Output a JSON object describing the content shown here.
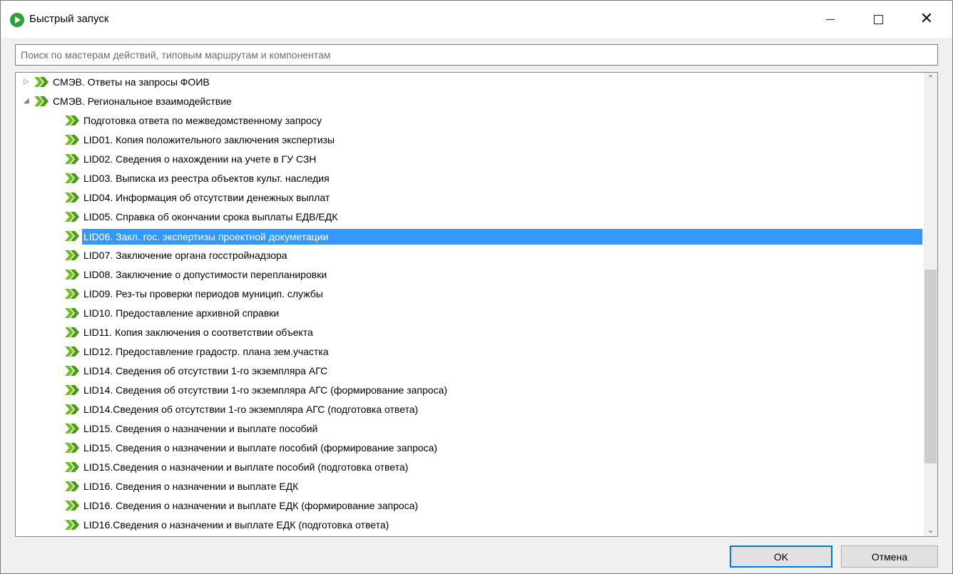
{
  "window": {
    "title": "Быстрый запуск",
    "icon": "play-circle-icon",
    "accent": "#2e9f3a",
    "selection_color": "#3399ff"
  },
  "search": {
    "placeholder": "Поиск по мастерам действий, типовым маршрутам и компонентам",
    "value": ""
  },
  "tree": {
    "items": [
      {
        "level": 0,
        "expander": "collapsed",
        "label": "СМЭВ. Ответы на запросы ФОИВ"
      },
      {
        "level": 0,
        "expander": "expanded",
        "label": "СМЭВ. Региональное взаимодействие"
      },
      {
        "level": 1,
        "label": " Подготовка ответа по межведомственному запросу"
      },
      {
        "level": 1,
        "label": "LID01. Копия положительного заключения экспертизы"
      },
      {
        "level": 1,
        "label": "LID02. Сведения о нахождении на учете в ГУ СЗН"
      },
      {
        "level": 1,
        "label": "LID03. Выписка из реестра объектов культ. наследия"
      },
      {
        "level": 1,
        "label": "LID04. Информация об отсутствии денежных выплат"
      },
      {
        "level": 1,
        "label": "LID05. Справка об окончании срока выплаты ЕДВ/ЕДК"
      },
      {
        "level": 1,
        "label": "LID06. Закл. гос. экспертизы проектной докуметации",
        "selected": true
      },
      {
        "level": 1,
        "label": "LID07. Заключение органа госстройнадзора"
      },
      {
        "level": 1,
        "label": "LID08. Заключение о допустимости перепланировки"
      },
      {
        "level": 1,
        "label": "LID09. Рез-ты проверки периодов муницип. службы"
      },
      {
        "level": 1,
        "label": "LID10. Предоставление архивной справки"
      },
      {
        "level": 1,
        "label": "LID11. Копия заключения о соответствии объекта"
      },
      {
        "level": 1,
        "label": "LID12. Предоставление градостр. плана зем.участка"
      },
      {
        "level": 1,
        "label": "LID14. Сведения об отсутствии 1-го экземпляра АГС"
      },
      {
        "level": 1,
        "label": "LID14. Сведения об отсутствии 1-го экземпляра АГС (формирование запроса)"
      },
      {
        "level": 1,
        "label": "LID14.Сведения об отсутствии 1-го экземпляра АГС (подготовка ответа)"
      },
      {
        "level": 1,
        "label": "LID15. Сведения о назначении и выплате пособий"
      },
      {
        "level": 1,
        "label": "LID15. Сведения о назначении и выплате пособий (формирование запроса)"
      },
      {
        "level": 1,
        "label": "LID15.Сведения о назначении и выплате пособий (подготовка ответа)"
      },
      {
        "level": 1,
        "label": "LID16. Сведения о назначении и выплате ЕДК"
      },
      {
        "level": 1,
        "label": "LID16. Сведения о назначении и выплате ЕДК (формирование запроса)"
      },
      {
        "level": 1,
        "label": "LID16.Сведения о назначении и выплате ЕДК (подготовка ответа)"
      },
      {
        "level": 1,
        "label": ""
      }
    ]
  },
  "buttons": {
    "ok": "OK",
    "cancel": "Отмена"
  }
}
